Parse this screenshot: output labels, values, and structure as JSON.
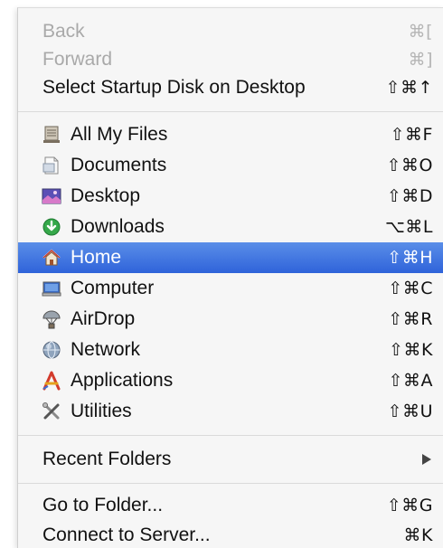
{
  "menu": {
    "nav": [
      {
        "label": "Back",
        "shortcut": "⌘[",
        "enabled": false
      },
      {
        "label": "Forward",
        "shortcut": "⌘]",
        "enabled": false
      },
      {
        "label": "Select Startup Disk on Desktop",
        "shortcut": "⇧⌘↑",
        "enabled": true
      }
    ],
    "places": [
      {
        "label": "All My Files",
        "shortcut": "⇧⌘F",
        "icon": "all-my-files-icon"
      },
      {
        "label": "Documents",
        "shortcut": "⇧⌘O",
        "icon": "documents-folder-icon"
      },
      {
        "label": "Desktop",
        "shortcut": "⇧⌘D",
        "icon": "desktop-icon"
      },
      {
        "label": "Downloads",
        "shortcut": "⌥⌘L",
        "icon": "downloads-icon"
      },
      {
        "label": "Home",
        "shortcut": "⇧⌘H",
        "icon": "home-icon",
        "selected": true
      },
      {
        "label": "Computer",
        "shortcut": "⇧⌘C",
        "icon": "computer-icon"
      },
      {
        "label": "AirDrop",
        "shortcut": "⇧⌘R",
        "icon": "airdrop-icon"
      },
      {
        "label": "Network",
        "shortcut": "⇧⌘K",
        "icon": "network-icon"
      },
      {
        "label": "Applications",
        "shortcut": "⇧⌘A",
        "icon": "applications-icon"
      },
      {
        "label": "Utilities",
        "shortcut": "⇧⌘U",
        "icon": "utilities-icon"
      }
    ],
    "recent": {
      "label": "Recent Folders",
      "submenu_icon": "submenu-arrow-icon"
    },
    "goto": [
      {
        "label": "Go to Folder...",
        "shortcut": "⇧⌘G"
      },
      {
        "label": "Connect to Server...",
        "shortcut": "⌘K"
      }
    ]
  },
  "colors": {
    "selection_top": "#5a8ee8",
    "selection_bottom": "#2f63da",
    "disabled_text": "#a9a9a9",
    "menu_bg": "#f6f6f6"
  }
}
